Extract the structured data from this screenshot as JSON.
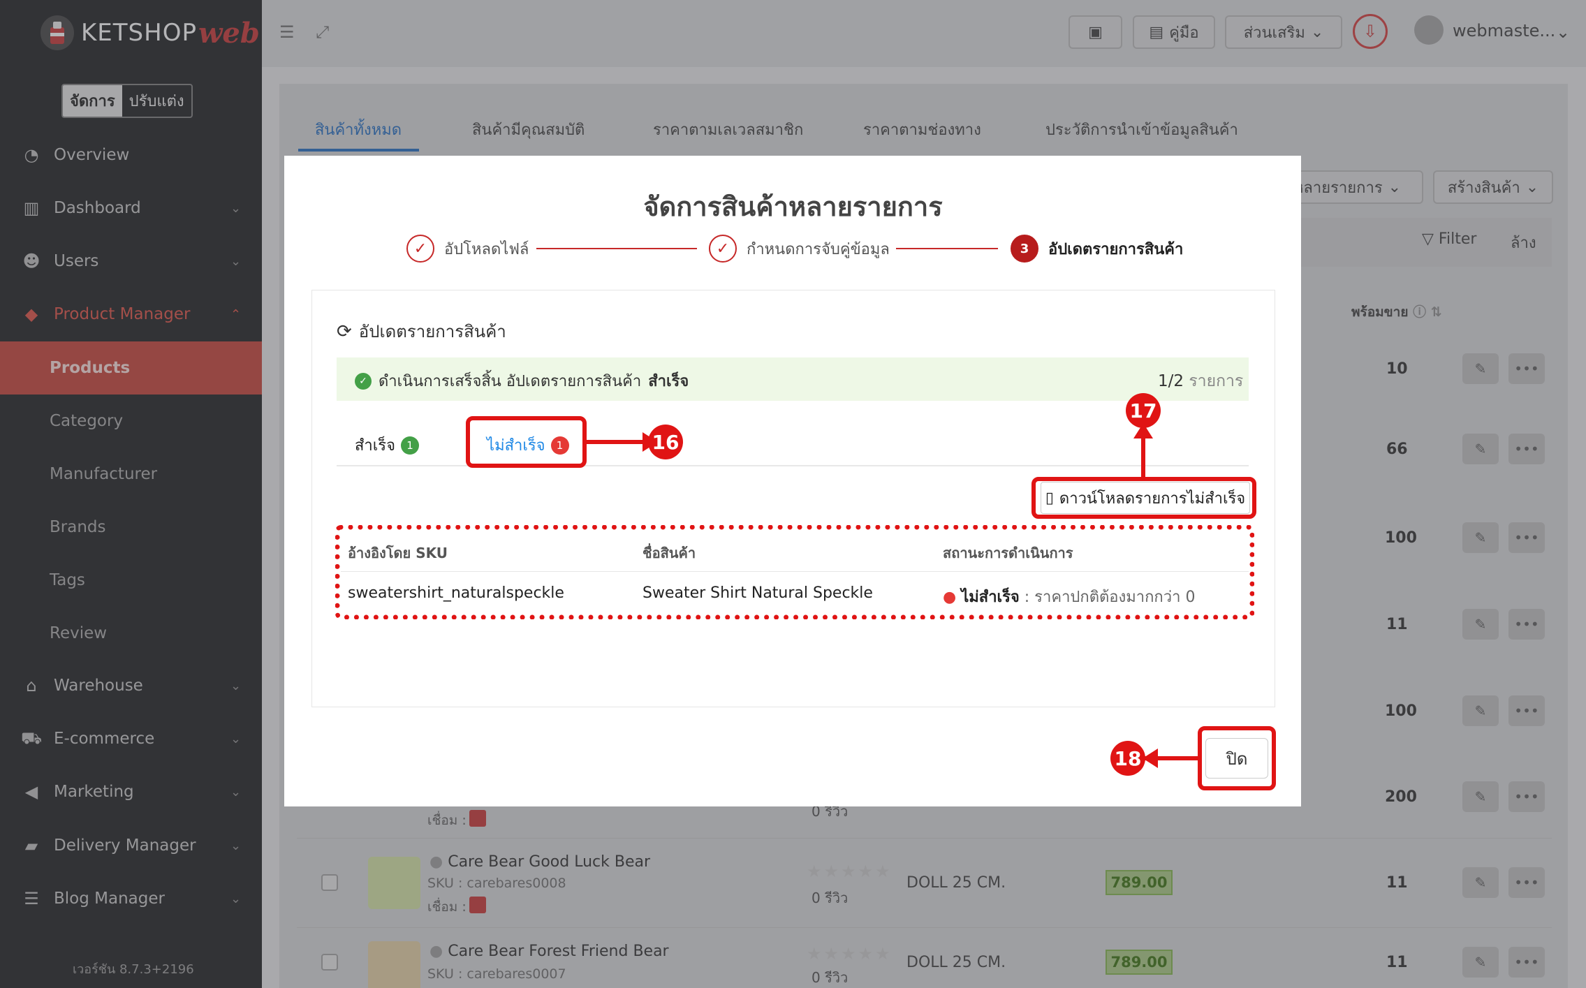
{
  "app": {
    "logo_text": "KETSHOP",
    "logo_suffix": "web",
    "mode_manage": "จัดการ",
    "mode_customize": "ปรับแต่ง",
    "version": "เวอร์ชัน 8.7.3+2196"
  },
  "sidebar": {
    "items": [
      {
        "label": "Overview",
        "icon": "pie-chart-icon"
      },
      {
        "label": "Dashboard",
        "icon": "bar-chart-icon"
      },
      {
        "label": "Users",
        "icon": "users-icon"
      },
      {
        "label": "Product Manager",
        "icon": "tags-icon"
      },
      {
        "label": "Warehouse",
        "icon": "warehouse-icon"
      },
      {
        "label": "E-commerce",
        "icon": "cart-icon"
      },
      {
        "label": "Marketing",
        "icon": "megaphone-icon"
      },
      {
        "label": "Delivery Manager",
        "icon": "truck-icon"
      },
      {
        "label": "Blog Manager",
        "icon": "blog-icon"
      }
    ],
    "sub_items": [
      "Products",
      "Category",
      "Manufacturer",
      "Brands",
      "Tags",
      "Review"
    ]
  },
  "topbar": {
    "manual": "คู่มือ",
    "addons": "ส่วนเสริม",
    "user": "webmaste..."
  },
  "tabs": [
    "สินค้าทั้งหมด",
    "สินค้ามีคุณสมบัติ",
    "ราคาตามเลเวลสมาชิก",
    "ราคาตามช่องทาง",
    "ประวัติการนำเข้าข้อมูลสินค้า"
  ],
  "toolbar": {
    "multi": "หลายรายการ",
    "create": "สร้างสินค้า",
    "filter": "Filter",
    "clear": "ล้าง"
  },
  "table": {
    "ready_col": "พร้อมขาย",
    "ready_values": [
      "10",
      "66",
      "100",
      "11",
      "100",
      "200",
      "11",
      "11"
    ]
  },
  "products": [
    {
      "name": "",
      "sku": "",
      "conn": "เชื่อม :",
      "reviews": "0 รีวิว"
    },
    {
      "name": "Care Bear Good Luck Bear",
      "sku": "SKU : carebares0008",
      "conn": "เชื่อม :",
      "reviews": "0 รีวิว",
      "size": "DOLL 25 CM.",
      "price": "789.00"
    },
    {
      "name": "Care Bear Forest Friend Bear",
      "sku": "SKU : carebares0007",
      "reviews": "0 รีวิว",
      "size": "DOLL 25 CM.",
      "price": "789.00"
    }
  ],
  "modal": {
    "title": "จัดการสินค้าหลายรายการ",
    "steps": [
      {
        "n": "",
        "label": "อัปโหลดไฟล์"
      },
      {
        "n": "",
        "label": "กำหนดการจับคู่ข้อมูล"
      },
      {
        "n": "3",
        "label": "อัปเดตรายการสินค้า"
      }
    ],
    "section": "อัปเดตรายการสินค้า",
    "banner": {
      "prefix": "ดำเนินการเสร็จสิ้น อัปเดตรายการสินค้า",
      "result": "สำเร็จ",
      "count": "1/2",
      "unit": "รายการ"
    },
    "tab_success": "สำเร็จ",
    "tab_success_count": "1",
    "tab_fail": "ไม่สำเร็จ",
    "tab_fail_count": "1",
    "download": "ดาวน์โหลดรายการไม่สำเร็จ",
    "columns": [
      "อ้างอิงโดย SKU",
      "ชื่อสินค้า",
      "สถานะการดำเนินการ"
    ],
    "row": {
      "sku": "sweatershirt_naturalspeckle",
      "name": "Sweater Shirt Natural Speckle",
      "status": "ไม่สำเร็จ",
      "reason": ": ราคาปกติต้องมากกว่า 0"
    },
    "close": "ปิด"
  },
  "annotations": {
    "a16": "16",
    "a17": "17",
    "a18": "18"
  },
  "colors": {
    "accent": "#c62828",
    "link": "#1e88e5",
    "success": "#43a047",
    "annotation": "#e01414"
  }
}
